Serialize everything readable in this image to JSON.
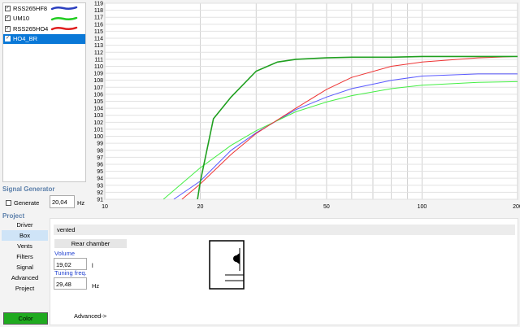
{
  "series": [
    {
      "name": "RSS265HF8",
      "checked": true,
      "color": "#2b3fbf",
      "selected": false
    },
    {
      "name": "UM10",
      "checked": true,
      "color": "#22cc22",
      "selected": false
    },
    {
      "name": "RSS265HO4",
      "checked": true,
      "color": "#e02020",
      "selected": false
    },
    {
      "name": "HO4_BR",
      "checked": true,
      "color": "#1a8f1a",
      "selected": true
    }
  ],
  "signal_generator": {
    "title": "Signal Generator",
    "generate_label": "Generate",
    "generate_checked": false,
    "frequency": "20,04",
    "unit": "Hz"
  },
  "project": {
    "title": "Project",
    "nav": [
      "Driver",
      "Box",
      "Vents",
      "Filters",
      "Signal",
      "Advanced",
      "Project"
    ],
    "active": "Box"
  },
  "color_button": {
    "label": "Color",
    "color": "#1faa1f"
  },
  "box_panel": {
    "box_type": "vented",
    "chamber_tab": "Rear chamber",
    "volume_label": "Volume",
    "volume_value": "19,02",
    "volume_unit": "l",
    "tuning_label": "Tuning freq.",
    "tuning_value": "29,48",
    "tuning_unit": "Hz",
    "advanced_link": "Advanced->"
  },
  "chart_data": {
    "type": "line",
    "x_scale": "log",
    "xlim": [
      10,
      200
    ],
    "ylim": [
      91,
      119
    ],
    "x_ticks": [
      "10",
      "20",
      "50",
      "100",
      "200"
    ],
    "y_ticks": [
      "91",
      "92",
      "93",
      "94",
      "95",
      "96",
      "97",
      "98",
      "99",
      "100",
      "101",
      "102",
      "103",
      "104",
      "105",
      "106",
      "107",
      "108",
      "109",
      "110",
      "111",
      "112",
      "113",
      "114",
      "115",
      "116",
      "117",
      "118",
      "119"
    ],
    "grid": true,
    "series": [
      {
        "name": "RSS265HF8",
        "color": "#5a5aff",
        "x": [
          16.5,
          20,
          25,
          30,
          40,
          50,
          60,
          80,
          100,
          150,
          200
        ],
        "y": [
          91,
          93.6,
          98,
          100.5,
          103.8,
          105.6,
          106.8,
          108.0,
          108.6,
          108.9,
          108.9
        ]
      },
      {
        "name": "UM10",
        "color": "#44ee44",
        "x": [
          15.3,
          20,
          25,
          30,
          40,
          50,
          60,
          80,
          100,
          150,
          200
        ],
        "y": [
          91,
          95.5,
          98.7,
          100.8,
          103.5,
          104.9,
          105.8,
          106.8,
          107.3,
          107.7,
          107.8
        ]
      },
      {
        "name": "RSS265HO4",
        "color": "#ee3333",
        "x": [
          17.5,
          20,
          25,
          30,
          40,
          50,
          60,
          80,
          100,
          150,
          200
        ],
        "y": [
          91,
          93.2,
          97.4,
          100.4,
          104.0,
          106.7,
          108.4,
          110.0,
          110.6,
          111.2,
          111.4
        ]
      },
      {
        "name": "HO4_BR",
        "color": "#20a020",
        "x": [
          19.6,
          20,
          22,
          25,
          30,
          35,
          40,
          50,
          60,
          80,
          100,
          150,
          200
        ],
        "y": [
          91,
          93.5,
          102.5,
          105.6,
          109.3,
          110.6,
          111.0,
          111.2,
          111.3,
          111.3,
          111.4,
          111.4,
          111.4
        ]
      }
    ]
  }
}
